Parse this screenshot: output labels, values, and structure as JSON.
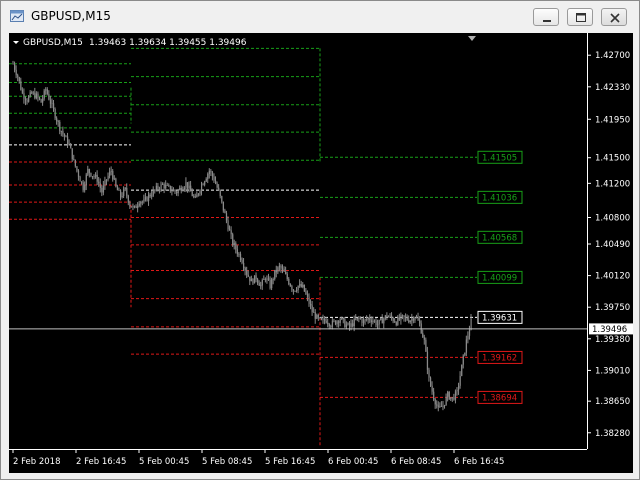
{
  "window": {
    "title": "GBPUSD,M15",
    "buttons": [
      {
        "name": "minimize",
        "icon": "minimize-icon"
      },
      {
        "name": "maximize",
        "icon": "maximize-icon"
      },
      {
        "name": "close",
        "icon": "close-icon"
      }
    ]
  },
  "colors": {
    "background": "#000000",
    "candles": "#8a8a8a",
    "resistance": "#18a018",
    "support": "#e01818",
    "current_level": "#ffffff",
    "bid_line": "#c0c0c0",
    "axis_text": "#ffffff"
  },
  "chart": {
    "header": {
      "symbol": "GBPUSD,M15",
      "ohlc": "1.39463 1.39634 1.39455 1.39496"
    },
    "current_price": "1.39496",
    "price_ticks": [
      "1.42700",
      "1.42330",
      "1.41950",
      "1.41500",
      "1.41200",
      "1.40800",
      "1.40490",
      "1.40120",
      "1.39750",
      "1.39380",
      "1.39010",
      "1.38650",
      "1.38280"
    ],
    "time_ticks": [
      "2 Feb 2018",
      "2 Feb 16:45",
      "5 Feb 00:45",
      "5 Feb 08:45",
      "5 Feb 16:45",
      "6 Feb 00:45",
      "6 Feb 08:45",
      "6 Feb 16:45"
    ],
    "level_labels": [
      {
        "value": "1.41505",
        "kind": "resistance"
      },
      {
        "value": "1.41036",
        "kind": "resistance"
      },
      {
        "value": "1.40568",
        "kind": "resistance"
      },
      {
        "value": "1.40099",
        "kind": "resistance"
      },
      {
        "value": "1.39631",
        "kind": "current"
      },
      {
        "value": "1.39162",
        "kind": "support"
      },
      {
        "value": "1.38694",
        "kind": "support"
      }
    ]
  },
  "chart_data": {
    "type": "candlestick",
    "symbol": "GBPUSD",
    "timeframe": "M15",
    "x_ticks": [
      "2 Feb 2018",
      "2 Feb 16:45",
      "5 Feb 00:45",
      "5 Feb 08:45",
      "5 Feb 16:45",
      "6 Feb 00:45",
      "6 Feb 08:45",
      "6 Feb 16:45"
    ],
    "ylim": [
      1.3809,
      1.4296
    ],
    "y_ticks": [
      1.427,
      1.4233,
      1.4195,
      1.415,
      1.412,
      1.408,
      1.4049,
      1.4012,
      1.3975,
      1.3938,
      1.3901,
      1.3865,
      1.3828
    ],
    "last_price": 1.39496,
    "close_path": [
      [
        0,
        1.426
      ],
      [
        3,
        1.4245
      ],
      [
        6,
        1.4225
      ],
      [
        9,
        1.4218
      ],
      [
        12,
        1.4225
      ],
      [
        15,
        1.4222
      ],
      [
        18,
        1.4215
      ],
      [
        21,
        1.423
      ],
      [
        24,
        1.4215
      ],
      [
        27,
        1.42
      ],
      [
        30,
        1.4185
      ],
      [
        33,
        1.4175
      ],
      [
        36,
        1.4165
      ],
      [
        39,
        1.4145
      ],
      [
        42,
        1.413
      ],
      [
        45,
        1.4115
      ],
      [
        48,
        1.4135
      ],
      [
        51,
        1.413
      ],
      [
        54,
        1.4125
      ],
      [
        57,
        1.411
      ],
      [
        60,
        1.4125
      ],
      [
        63,
        1.4135
      ],
      [
        66,
        1.4115
      ],
      [
        69,
        1.4105
      ],
      [
        72,
        1.4112
      ],
      [
        75,
        1.4095
      ],
      [
        78,
        1.409
      ],
      [
        81,
        1.41
      ],
      [
        84,
        1.4098
      ],
      [
        87,
        1.4105
      ],
      [
        90,
        1.411
      ],
      [
        93,
        1.4115
      ],
      [
        96,
        1.4118
      ],
      [
        99,
        1.4115
      ],
      [
        102,
        1.4112
      ],
      [
        105,
        1.411
      ],
      [
        108,
        1.4115
      ],
      [
        111,
        1.412
      ],
      [
        114,
        1.411
      ],
      [
        117,
        1.41
      ],
      [
        120,
        1.4115
      ],
      [
        123,
        1.4125
      ],
      [
        126,
        1.4135
      ],
      [
        129,
        1.4125
      ],
      [
        132,
        1.411
      ],
      [
        135,
        1.409
      ],
      [
        138,
        1.407
      ],
      [
        141,
        1.405
      ],
      [
        144,
        1.404
      ],
      [
        147,
        1.403
      ],
      [
        150,
        1.4015
      ],
      [
        153,
        1.4005
      ],
      [
        156,
        1.401
      ],
      [
        159,
        1.4
      ],
      [
        162,
        1.401
      ],
      [
        165,
        1.4
      ],
      [
        168,
        1.4015
      ],
      [
        171,
        1.4022
      ],
      [
        174,
        1.4015
      ],
      [
        177,
        1.4005
      ],
      [
        180,
        1.3995
      ],
      [
        183,
        1.4
      ],
      [
        186,
        1.3998
      ],
      [
        189,
        1.3985
      ],
      [
        192,
        1.397
      ],
      [
        195,
        1.3962
      ],
      [
        198,
        1.3958
      ],
      [
        201,
        1.396
      ],
      [
        204,
        1.3955
      ],
      [
        207,
        1.3958
      ],
      [
        210,
        1.3962
      ],
      [
        213,
        1.3955
      ],
      [
        216,
        1.3952
      ],
      [
        219,
        1.3958
      ],
      [
        222,
        1.3962
      ],
      [
        225,
        1.3958
      ],
      [
        228,
        1.3962
      ],
      [
        231,
        1.396
      ],
      [
        234,
        1.3955
      ],
      [
        237,
        1.396
      ],
      [
        240,
        1.3965
      ],
      [
        243,
        1.3962
      ],
      [
        246,
        1.3958
      ],
      [
        249,
        1.3962
      ],
      [
        252,
        1.3962
      ],
      [
        255,
        1.396
      ],
      [
        258,
        1.3965
      ],
      [
        261,
        1.3955
      ],
      [
        264,
        1.3935
      ],
      [
        267,
        1.389
      ],
      [
        270,
        1.387
      ],
      [
        273,
        1.3855
      ],
      [
        276,
        1.386
      ],
      [
        279,
        1.3872
      ],
      [
        282,
        1.3868
      ],
      [
        285,
        1.3875
      ],
      [
        288,
        1.3905
      ],
      [
        291,
        1.3935
      ],
      [
        294,
        1.3958
      ]
    ],
    "levels": {
      "resistance": [
        1.41505,
        1.41036,
        1.40568,
        1.40099
      ],
      "current": 1.39631,
      "support": [
        1.39162,
        1.38694
      ]
    }
  }
}
